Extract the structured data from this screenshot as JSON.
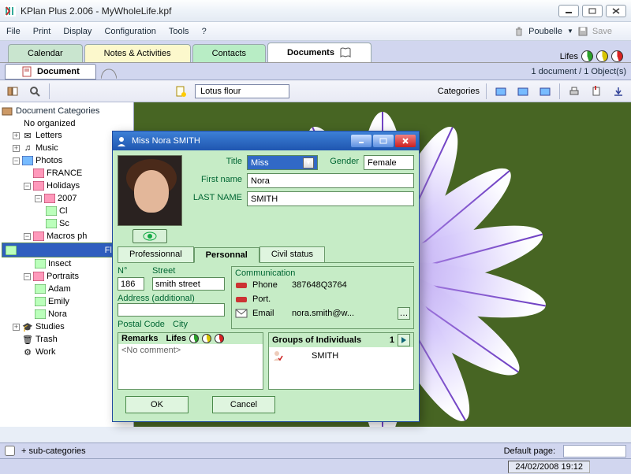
{
  "window": {
    "title": "KPlan Plus 2.006 - MyWholeLife.kpf"
  },
  "menu": {
    "file": "File",
    "print": "Print",
    "display": "Display",
    "configuration": "Configuration",
    "tools": "Tools",
    "help": "?",
    "poubelle": "Poubelle",
    "save": "Save"
  },
  "tabs": {
    "calendar": "Calendar",
    "notes": "Notes & Activities",
    "contacts": "Contacts",
    "documents": "Documents",
    "lifes": "Lifes"
  },
  "subheader": {
    "tab": "Document",
    "status": "1 document / 1 Object(s)"
  },
  "toolbar": {
    "doc_name": "Lotus flour",
    "categories": "Categories"
  },
  "tree": {
    "header": "Document Categories",
    "no_org": "No organized",
    "letters": "Letters",
    "music": "Music",
    "photos": "Photos",
    "france": "FRANCE",
    "holidays": "Holidays",
    "y2007": "2007",
    "cl": "Cl",
    "sc": "Sc",
    "macros": "Macros ph",
    "flowers": "Flowe",
    "insects": "Insect",
    "portraits": "Portraits",
    "adam": "Adam",
    "emily": "Emily",
    "nora": "Nora",
    "studies": "Studies",
    "trash": "Trash",
    "work": "Work"
  },
  "footer": {
    "subcat": "+ sub-categories",
    "default_page": "Default page:",
    "datetime": "24/02/2008 19:12"
  },
  "dialog": {
    "title": "Miss Nora SMITH",
    "labels": {
      "title": "Title",
      "gender": "Gender",
      "first_name": "First name",
      "last_name": "LAST NAME",
      "n": "N°",
      "street": "Street",
      "address_add": "Address (additional)",
      "postal": "Postal Code",
      "city": "City",
      "communication": "Communication",
      "phone": "Phone",
      "port": "Port.",
      "email": "Email",
      "remarks": "Remarks",
      "lifes": "Lifes",
      "groups": "Groups of Individuals",
      "groups_count": "1"
    },
    "values": {
      "title": "Miss",
      "gender": "Female",
      "first_name": "Nora",
      "last_name": "SMITH",
      "n": "186",
      "street": "smith street",
      "phone": "387648Q3764",
      "email": "nora.smith@w...",
      "remarks": "<No comment>",
      "group_name": "SMITH"
    },
    "subtabs": {
      "pro": "Professionnal",
      "pers": "Personnal",
      "civil": "Civil status"
    },
    "buttons": {
      "ok": "OK",
      "cancel": "Cancel"
    }
  }
}
